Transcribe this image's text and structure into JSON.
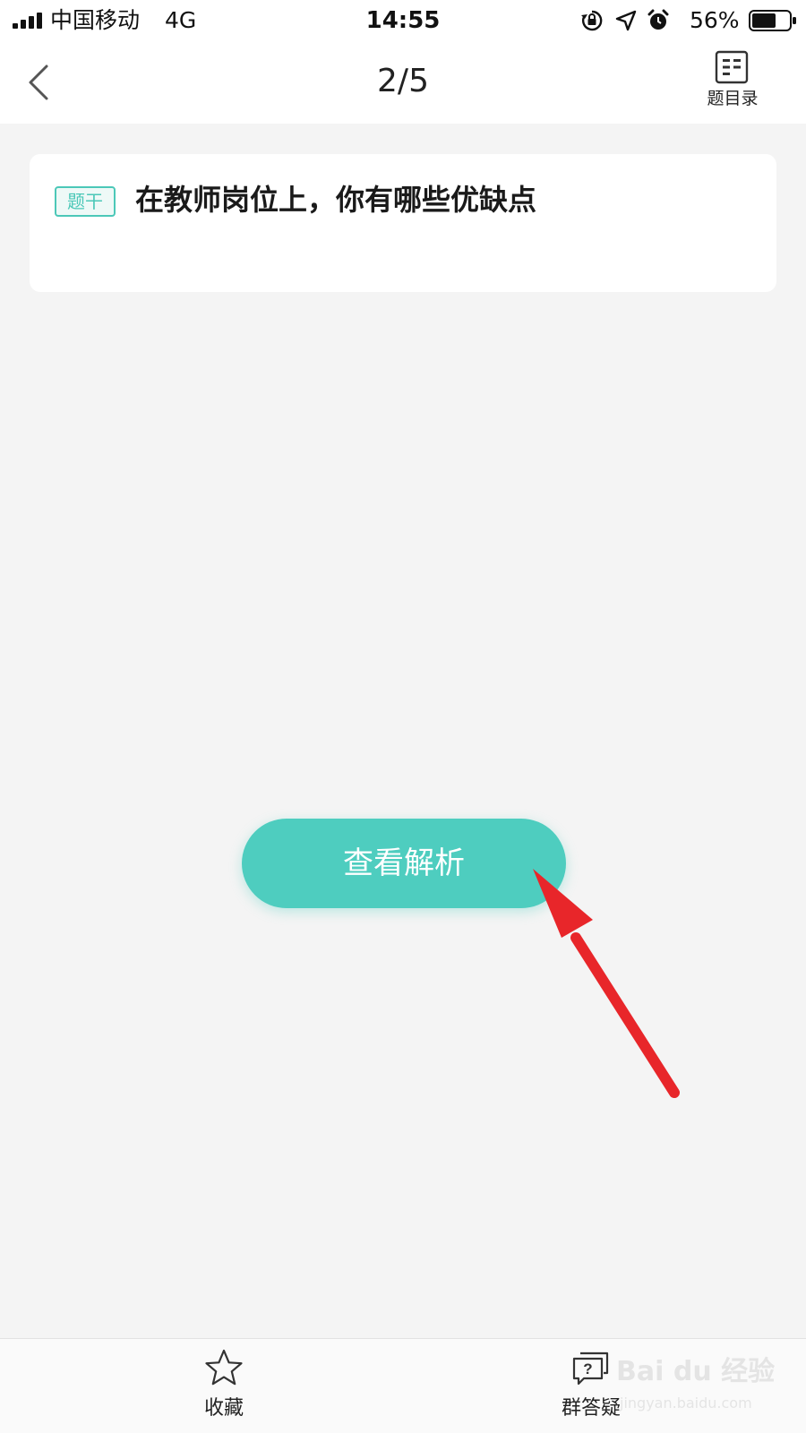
{
  "status_bar": {
    "carrier": "中国移动",
    "network": "4G",
    "time": "14:55",
    "battery_percent": "56%",
    "icons": [
      "signal-icon",
      "orientation-lock-icon",
      "location-icon",
      "alarm-icon",
      "battery-icon"
    ]
  },
  "nav": {
    "back_icon": "chevron-left-icon",
    "title": "2/5",
    "catalog_icon": "list-icon",
    "catalog_label": "题目录"
  },
  "question": {
    "tag": "题干",
    "text": "在教师岗位上，你有哪些优缺点"
  },
  "main": {
    "analysis_button_label": "查看解析"
  },
  "annotation": {
    "icon": "red-arrow-icon",
    "color": "#e8262a"
  },
  "bottom_bar": {
    "items": [
      {
        "icon": "star-icon",
        "label": "收藏"
      },
      {
        "icon": "question-chat-icon",
        "label": "群答疑"
      }
    ]
  },
  "watermark": {
    "brand": "Bai du 经验",
    "url": "jingyan.baidu.com"
  },
  "colors": {
    "accent": "#4ecdbf",
    "background": "#f4f4f4",
    "card": "#ffffff"
  }
}
